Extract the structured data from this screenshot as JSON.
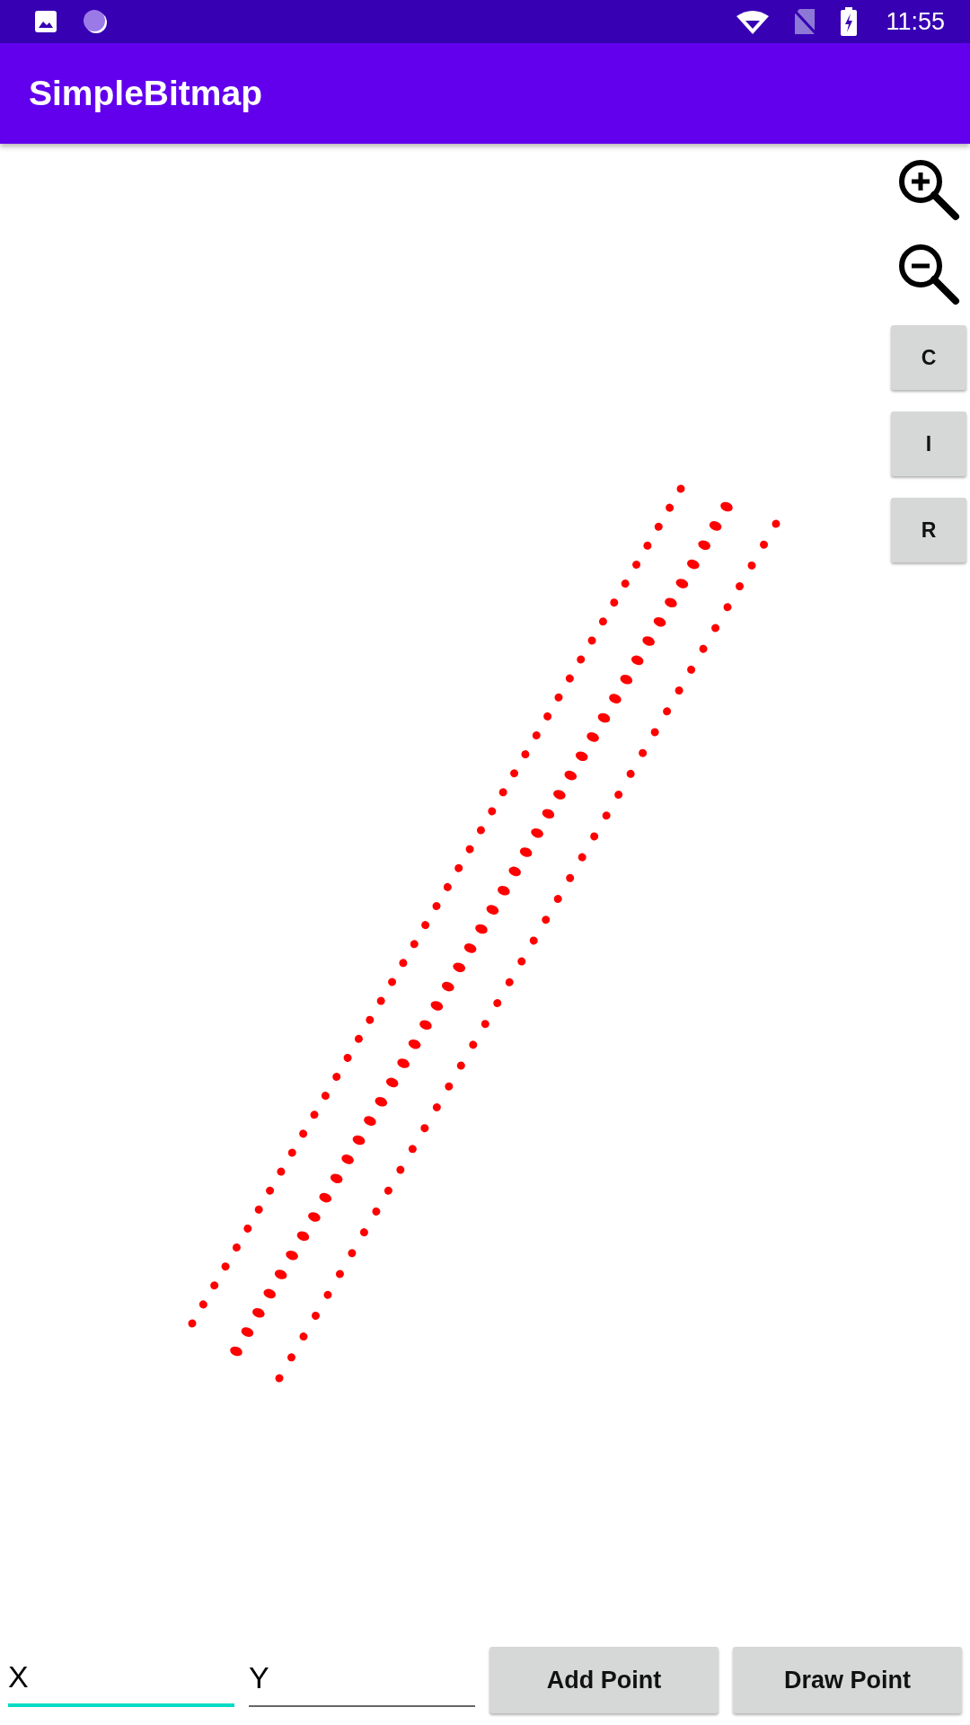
{
  "status_bar": {
    "time": "11:55"
  },
  "app_bar": {
    "title": "SimpleBitmap"
  },
  "side_buttons": [
    {
      "kind": "zoom_in"
    },
    {
      "kind": "zoom_out"
    },
    {
      "kind": "text",
      "label": "C"
    },
    {
      "kind": "text",
      "label": "I"
    },
    {
      "kind": "text",
      "label": "R"
    }
  ],
  "fields": [
    {
      "value": "X",
      "focused": true
    },
    {
      "value": "Y",
      "focused": false
    }
  ],
  "buttons": [
    "Add Point",
    "Draw Point"
  ]
}
